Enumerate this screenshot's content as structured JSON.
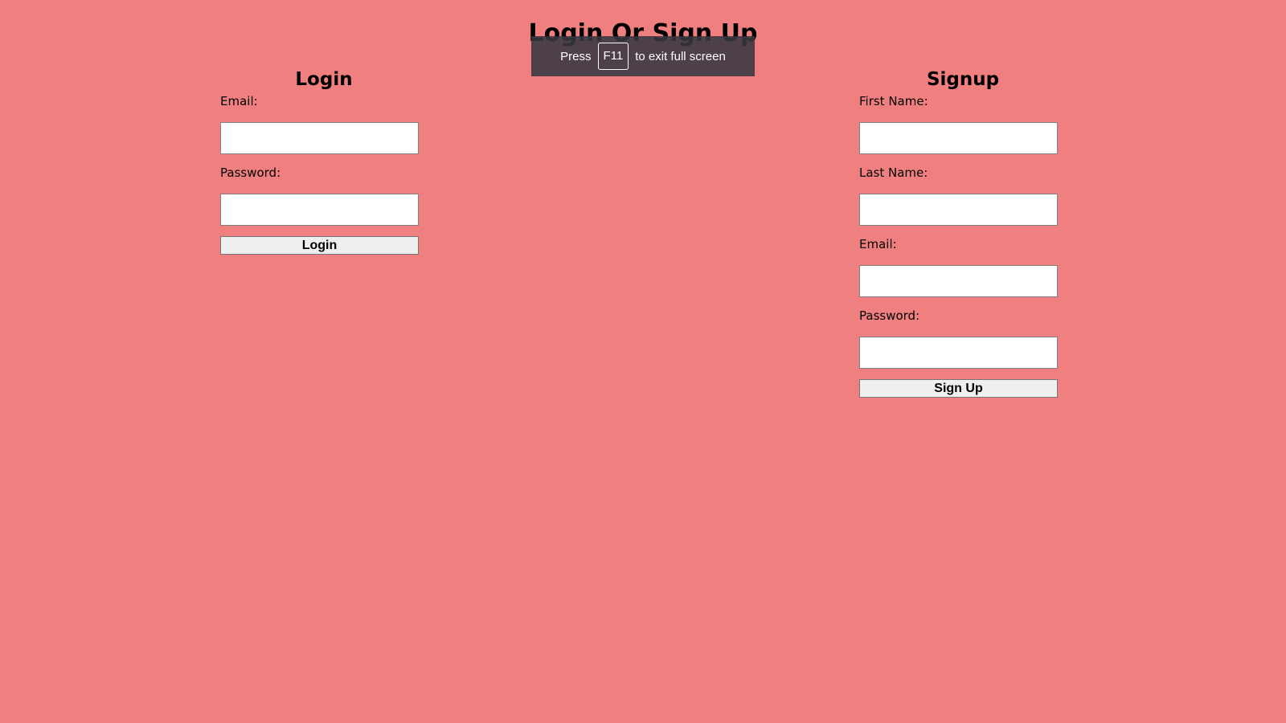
{
  "page": {
    "title": "Login Or Sign Up",
    "background_color": "#f08080"
  },
  "fullscreen_notice": {
    "prefix": "Press",
    "key": "F11",
    "suffix": "to exit full screen"
  },
  "login": {
    "heading": "Login",
    "email_label": "Email:",
    "email_value": "",
    "password_label": "Password:",
    "password_value": "",
    "button_label": "Login"
  },
  "signup": {
    "heading": "Signup",
    "first_name_label": "First Name:",
    "first_name_value": "",
    "last_name_label": "Last Name:",
    "last_name_value": "",
    "email_label": "Email:",
    "email_value": "",
    "password_label": "Password:",
    "password_value": "",
    "button_label": "Sign Up"
  }
}
